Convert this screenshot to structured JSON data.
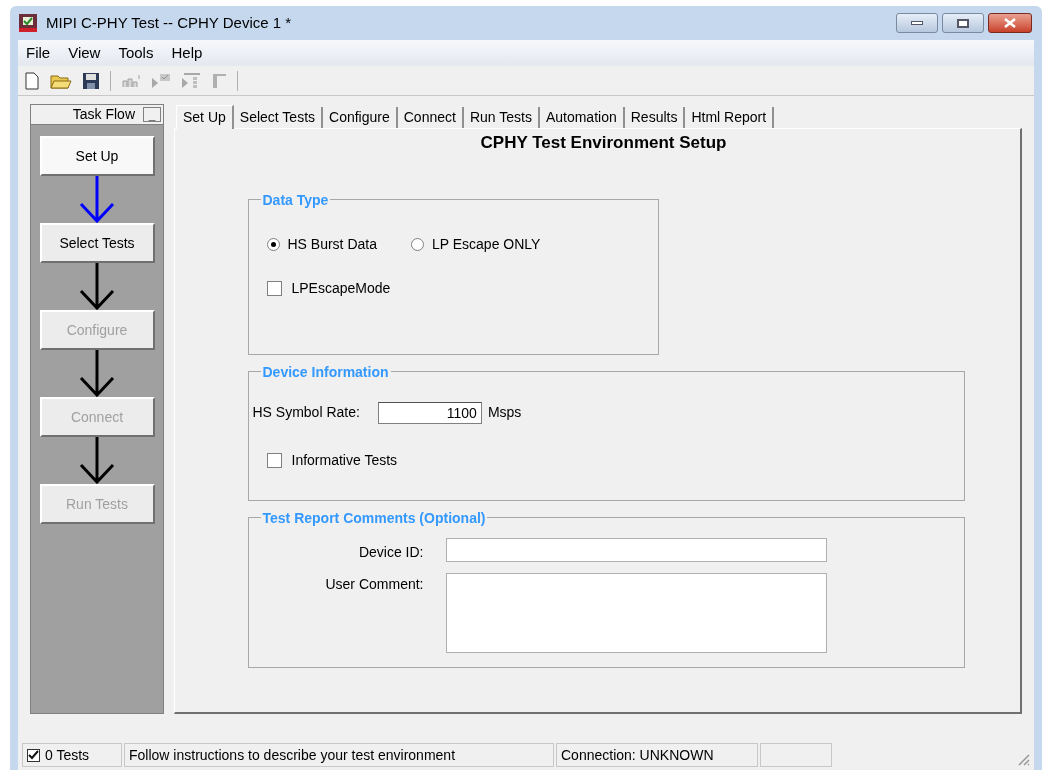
{
  "window": {
    "title": "MIPI C-PHY Test -- CPHY Device 1 *"
  },
  "menu": [
    "File",
    "View",
    "Tools",
    "Help"
  ],
  "task_flow": {
    "title": "Task Flow",
    "collapse": "_",
    "steps": [
      {
        "label": "Set Up",
        "selected": true,
        "disabled": false
      },
      {
        "label": "Select Tests",
        "selected": false,
        "disabled": false
      },
      {
        "label": "Configure",
        "selected": false,
        "disabled": true
      },
      {
        "label": "Connect",
        "selected": false,
        "disabled": true
      },
      {
        "label": "Run Tests",
        "selected": false,
        "disabled": true
      }
    ]
  },
  "tabs": [
    {
      "label": "Set Up",
      "selected": true
    },
    {
      "label": "Select Tests",
      "selected": false
    },
    {
      "label": "Configure",
      "selected": false
    },
    {
      "label": "Connect",
      "selected": false
    },
    {
      "label": "Run Tests",
      "selected": false
    },
    {
      "label": "Automation",
      "selected": false
    },
    {
      "label": "Results",
      "selected": false
    },
    {
      "label": "Html Report",
      "selected": false
    }
  ],
  "heading": "CPHY Test Environment Setup",
  "data_type": {
    "title": "Data Type",
    "radios": [
      {
        "label": "HS Burst Data",
        "selected": true
      },
      {
        "label": "LP Escape ONLY",
        "selected": false
      }
    ],
    "checkbox": {
      "label": "LPEscapeMode",
      "checked": false
    }
  },
  "device_information": {
    "title": "Device Information",
    "rate_label": "HS Symbol Rate:",
    "rate_value": "1100",
    "rate_unit": "Msps",
    "checkbox": {
      "label": "Informative Tests",
      "checked": false
    }
  },
  "comments": {
    "title": "Test Report Comments (Optional)",
    "device_id_label": "Device ID:",
    "user_comment_label": "User Comment:"
  },
  "status_bar": {
    "tests": {
      "label": "0 Tests",
      "checked": true
    },
    "message": "Follow instructions to describe your test environment",
    "connection": "Connection: UNKNOWN"
  }
}
